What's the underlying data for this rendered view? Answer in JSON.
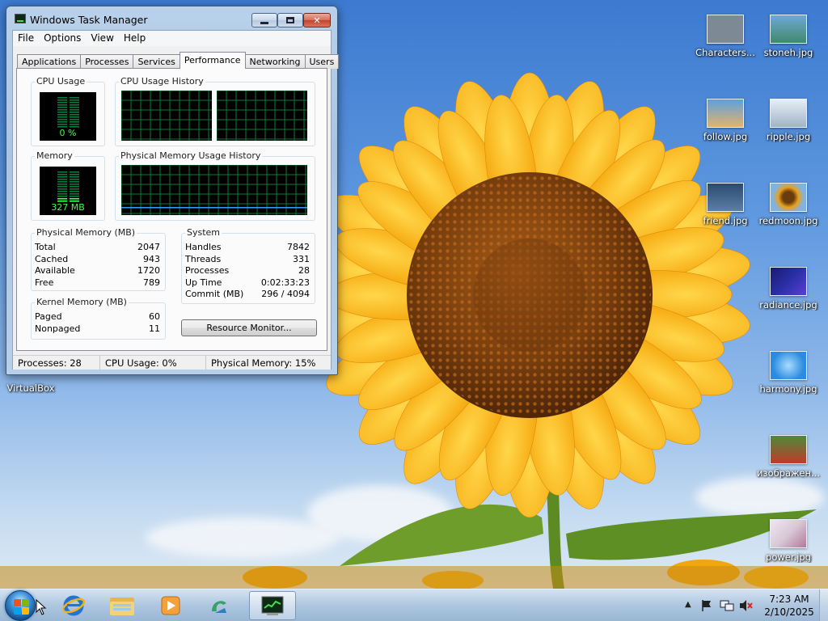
{
  "window": {
    "title": "Windows Task Manager",
    "menu": [
      "File",
      "Options",
      "View",
      "Help"
    ],
    "tabs": [
      "Applications",
      "Processes",
      "Services",
      "Performance",
      "Networking",
      "Users"
    ],
    "active_tab": "Performance"
  },
  "performance": {
    "cpu_usage_title": "CPU Usage",
    "cpu_usage_value": "0 %",
    "cpu_history_title": "CPU Usage History",
    "memory_title": "Memory",
    "memory_value": "327 MB",
    "memory_history_title": "Physical Memory Usage History",
    "cpu_fraction": 0.0,
    "memory_fraction": 0.15
  },
  "physical_memory": {
    "title": "Physical Memory (MB)",
    "rows": [
      {
        "label": "Total",
        "value": "2047"
      },
      {
        "label": "Cached",
        "value": "943"
      },
      {
        "label": "Available",
        "value": "1720"
      },
      {
        "label": "Free",
        "value": "789"
      }
    ]
  },
  "kernel_memory": {
    "title": "Kernel Memory (MB)",
    "rows": [
      {
        "label": "Paged",
        "value": "60"
      },
      {
        "label": "Nonpaged",
        "value": "11"
      }
    ]
  },
  "system": {
    "title": "System",
    "rows": [
      {
        "label": "Handles",
        "value": "7842"
      },
      {
        "label": "Threads",
        "value": "331"
      },
      {
        "label": "Processes",
        "value": "28"
      },
      {
        "label": "Up Time",
        "value": "0:02:33:23"
      },
      {
        "label": "Commit (MB)",
        "value": "296 / 4094"
      }
    ]
  },
  "resource_monitor_label": "Resource Monitor...",
  "status": {
    "processes": "Processes: 28",
    "cpu": "CPU Usage: 0%",
    "memory": "Physical Memory: 15%"
  },
  "desktop_icons": [
    {
      "label": "Characters...",
      "color": "#7d8a96"
    },
    {
      "label": "stoneh.jpg",
      "color": "#3f8a6a"
    },
    {
      "label": "follow.jpg",
      "color": "#e2b36a"
    },
    {
      "label": "ripple.jpg",
      "color": "#9fb4c9"
    },
    {
      "label": "friend.jpg",
      "color": "#5a7fa8"
    },
    {
      "label": "redmoon.jpg",
      "color": "#e8a21d"
    },
    {
      "label": "radiance.jpg",
      "color": "#2a2fa8"
    },
    {
      "label": "harmony.jpg",
      "color": "#2b8be0"
    },
    {
      "label": "изображен...",
      "color": "#4b8a3b"
    },
    {
      "label": "power.jpg",
      "color": "#d9c8d8"
    },
    {
      "label": "VirtualBox",
      "color": "#1b4fa0"
    }
  ],
  "taskbar": {
    "items": [
      "internet-explorer",
      "windows-explorer",
      "media-player",
      "virtualbox",
      "task-manager"
    ],
    "time": "7:23 AM",
    "date": "2/10/2025"
  }
}
